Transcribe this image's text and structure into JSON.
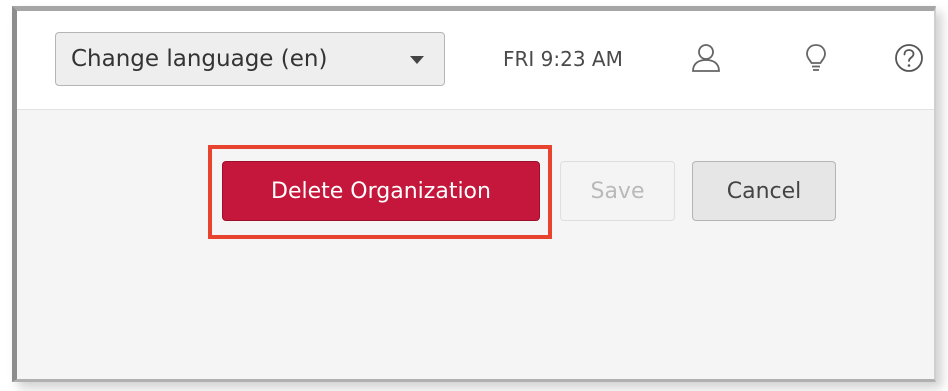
{
  "header": {
    "language_select": {
      "selected": "Change language (en)"
    },
    "datetime": "FRI 9:23 AM",
    "icons": [
      "user-icon",
      "lightbulb-icon",
      "help-icon"
    ]
  },
  "actions": {
    "delete_label": "Delete Organization",
    "save_label": "Save",
    "cancel_label": "Cancel"
  },
  "colors": {
    "delete_button": "#c4173b",
    "highlight_border": "#e8432e"
  }
}
